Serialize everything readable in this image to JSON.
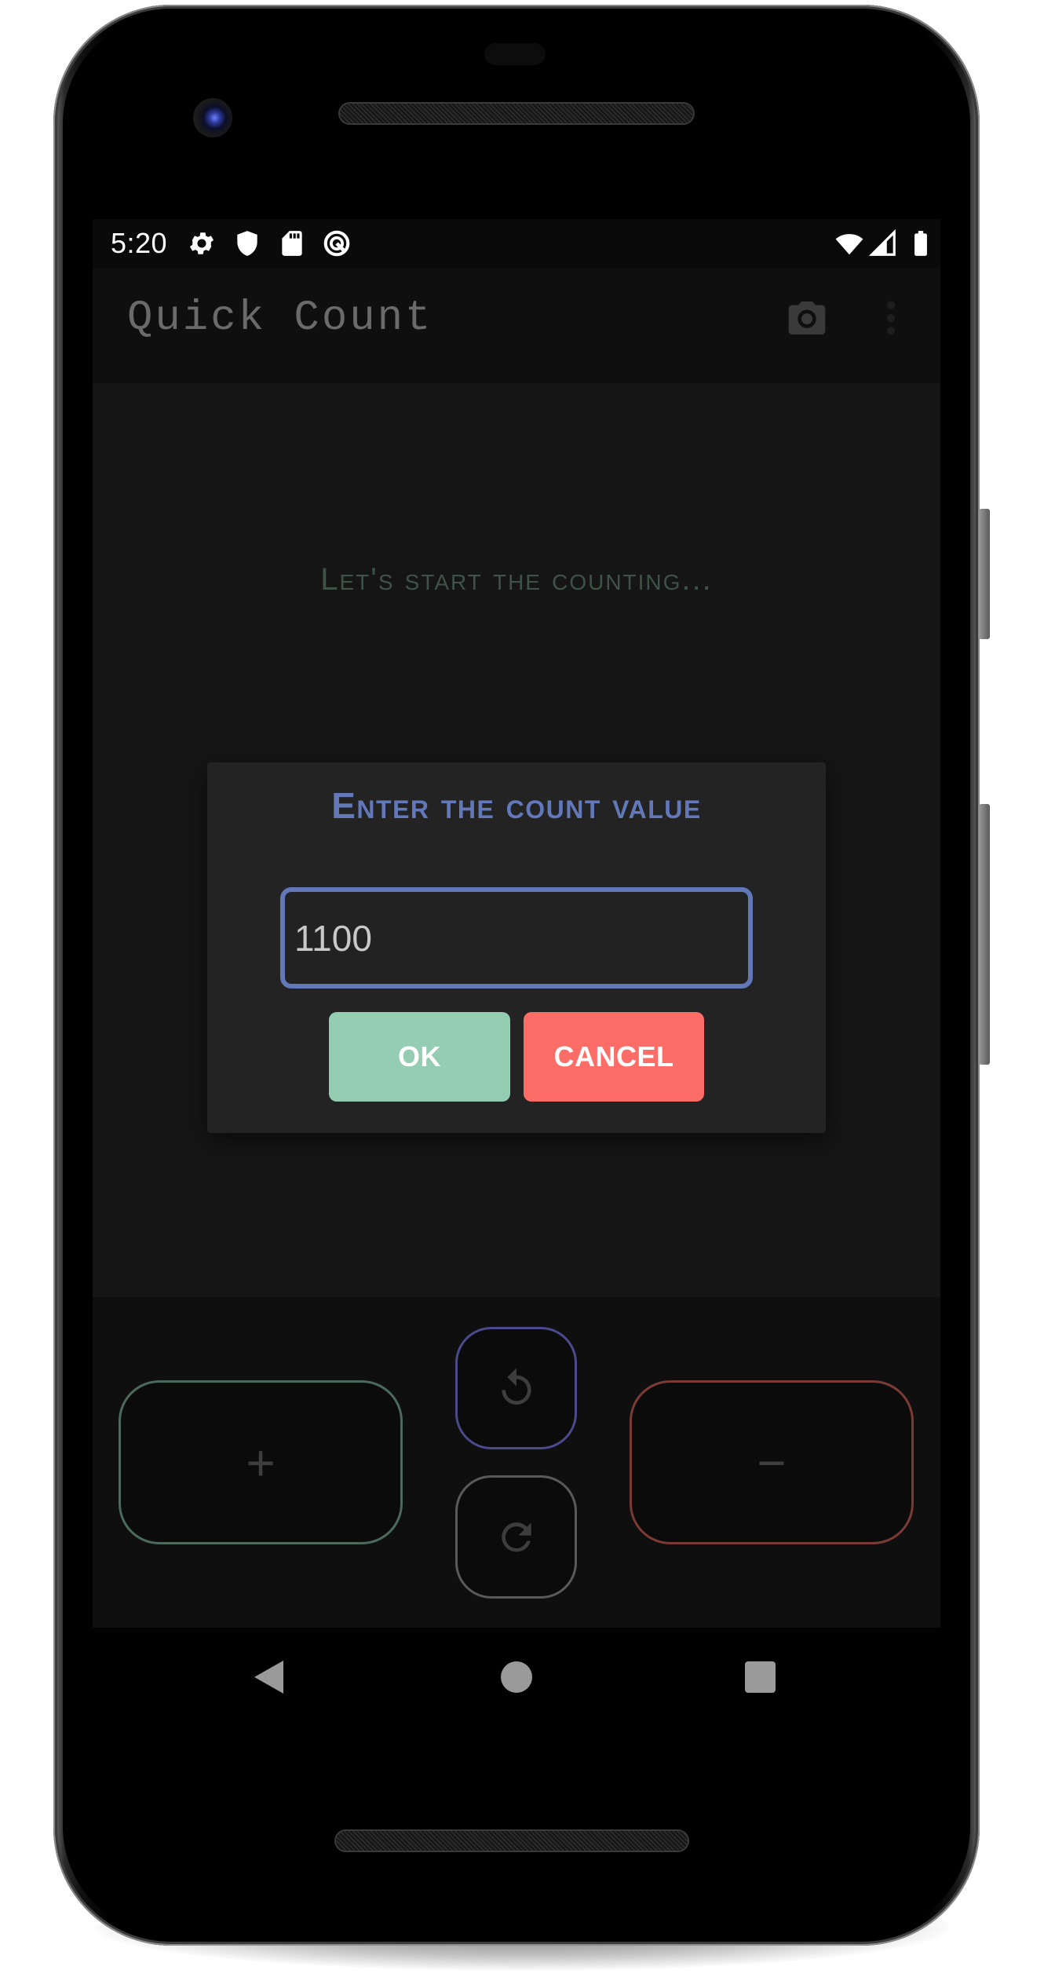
{
  "status_bar": {
    "time": "5:20",
    "left_icons": [
      "settings-icon",
      "shield-icon",
      "sd-card-icon",
      "vpn-q-icon"
    ],
    "right_icons": [
      "wifi-icon",
      "signal-icon",
      "battery-icon"
    ]
  },
  "app_bar": {
    "title": "Quick Count",
    "actions": [
      "camera-icon",
      "more-vert-icon"
    ]
  },
  "main": {
    "hint": "Let's start the counting..."
  },
  "dialog": {
    "title": "Enter the count value",
    "input_value": "1100",
    "ok_label": "OK",
    "cancel_label": "CANCEL"
  },
  "controls": {
    "plus_label": "+",
    "minus_label": "−",
    "undo_icon": "undo-icon",
    "redo_icon": "redo-icon"
  },
  "nav_bar": {
    "buttons": [
      "back",
      "home",
      "recents"
    ]
  },
  "colors": {
    "accent_blue": "#6278b8",
    "ok_green": "#95cdb3",
    "cancel_red": "#fd6d68",
    "plus_border": "#4b6a5c",
    "minus_border": "#7a3a36",
    "undo_border": "#4b4a8c"
  }
}
